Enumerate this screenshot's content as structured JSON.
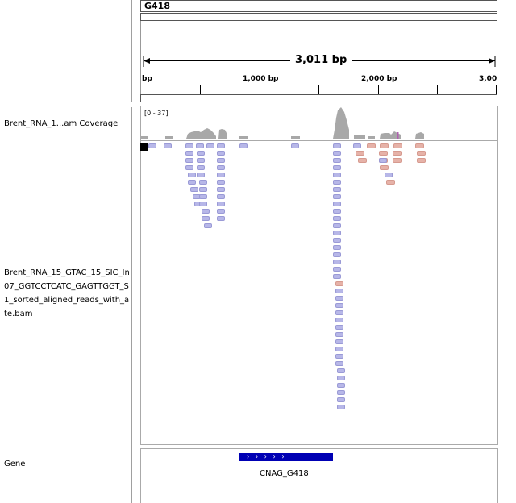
{
  "locus": {
    "chrom_label": "G418",
    "span": "3,011 bp"
  },
  "ruler": {
    "ticks": [
      "bp",
      "1,000 bp",
      "2,000 bp",
      "3,00"
    ]
  },
  "tracks": {
    "coverage_name": "Brent_RNA_1...am Coverage",
    "coverage_range": "[0 - 37]",
    "alignment_name_lines": [
      "Brent_RNA_15_GTAC_15_SIC_In",
      "07_GGTCCTCATC_GAGTTGGT_S",
      "1_sorted_aligned_reads_with_an",
      "te.bam"
    ],
    "gene_name": "Gene"
  },
  "gene": {
    "feature_label": "CNAG_G418",
    "strand_marks": "›   ›   ›   ›   ›"
  },
  "colors": {
    "read_forward": "#b7b7e8",
    "read_reverse": "#e6b2a8",
    "gene": "#0000b4",
    "coverage": "#a8a8a8"
  }
}
